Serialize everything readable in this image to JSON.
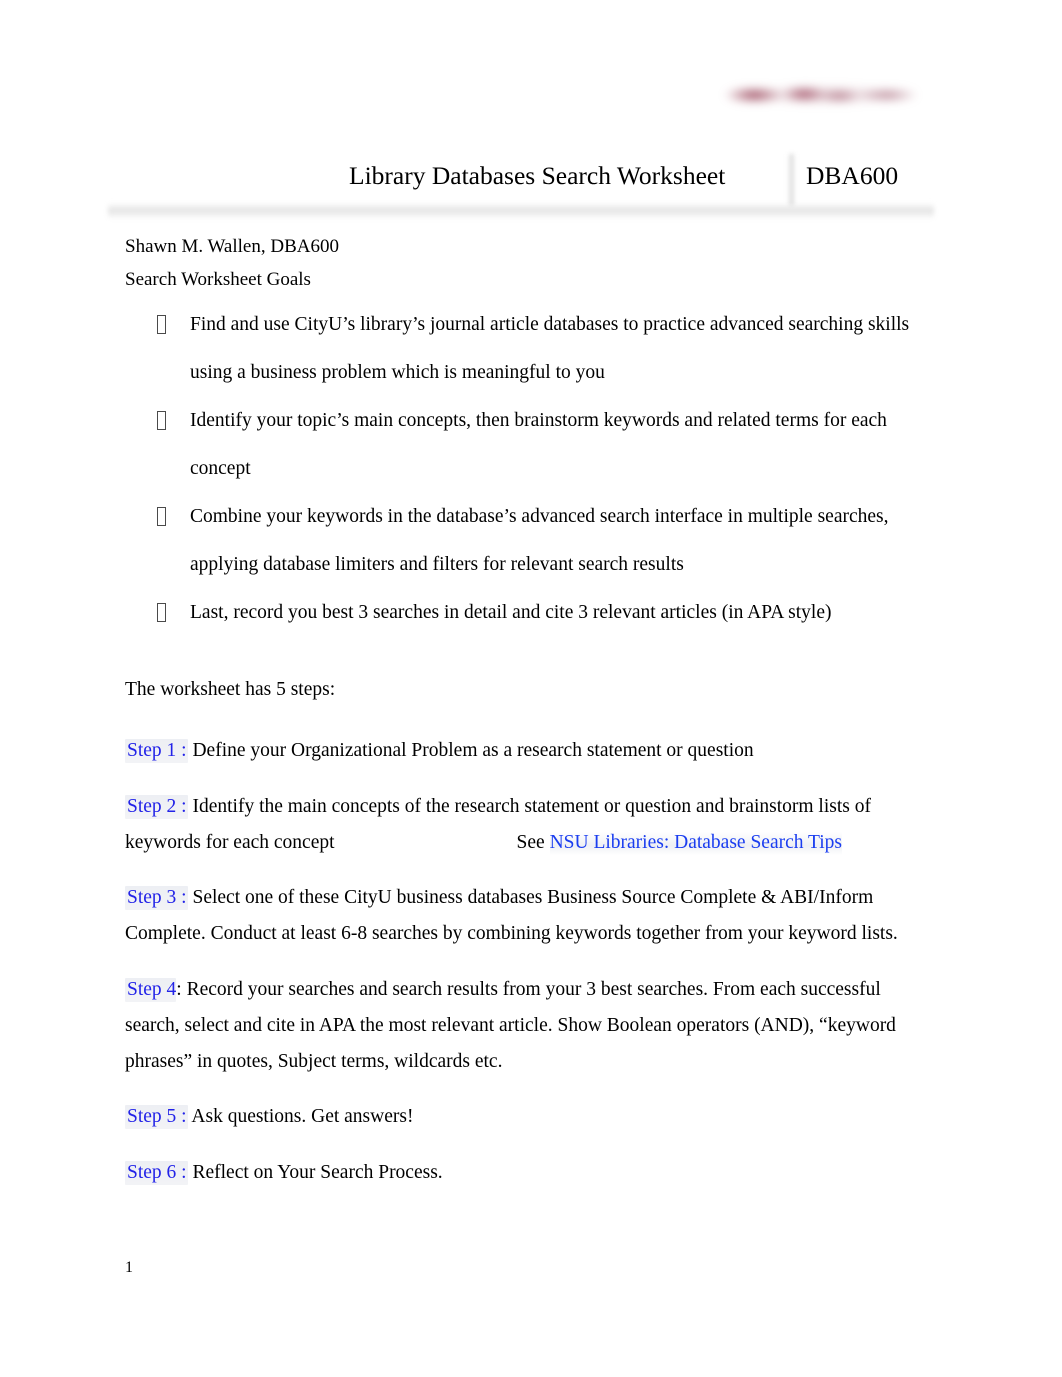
{
  "header": {
    "logo_alt": "blurred-university-logo",
    "logo_color": "#8c2a42",
    "title": "Library Databases Search Worksheet",
    "course_code": "DBA600"
  },
  "meta": {
    "author_line": "Shawn M. Wallen, DBA600",
    "section_heading": "Search Worksheet Goals"
  },
  "goals": [
    "Find and use CityU’s library’s journal article databases to practice advanced searching skills using a business problem which is meaningful to you",
    "Identify your topic’s main concepts, then brainstorm keywords and related terms for each concept",
    "Combine your keywords in the database’s advanced search interface in multiple searches, applying database limiters and filters for relevant search results",
    "Last, record you best 3 searches in detail and cite 3 relevant articles (in APA style)"
  ],
  "intro": "The worksheet has 5 steps:",
  "steps": [
    {
      "label": "Step 1 :",
      "label_text": "Step 1",
      "colon": " :",
      "body": " Define your Organizational Problem as a research statement or question"
    },
    {
      "label": "Step 2 :",
      "label_text": "Step 2",
      "colon": " :",
      "body": " Identify the main concepts of the research statement or question and brainstorm lists of keywords for each concept",
      "body_line1": " Identify the main concepts of the research statement or question and brainstorm lists of",
      "body_line2": "keywords for each concept",
      "see_label": "See",
      "link_text": "NSU Libraries: Database Search Tips"
    },
    {
      "label": "Step 3 :",
      "label_text": "Step 3",
      "colon": " :",
      "body": " Select one of these CityU business databases Business Source Complete & ABI/Inform Complete. Conduct at least 6-8 searches by combining keywords together from your keyword lists."
    },
    {
      "label": "Step 4 :",
      "label_text": "Step 4",
      "colon": ":",
      "body": " Record your searches and search results from your 3 best searches. From each successful search, select and cite in APA the most relevant article. Show Boolean operators (AND), “keyword phrases” in quotes, Subject terms, wildcards etc."
    },
    {
      "label": "Step 5 :",
      "label_text": "Step 5",
      "colon": " :",
      "body": " Ask questions. Get answers!"
    },
    {
      "label": "Step 6 :",
      "label_text": "Step 6",
      "colon": " :",
      "body": " Reflect on Your Search Process."
    }
  ],
  "footer": {
    "page_number": "1"
  },
  "colors": {
    "step_label_blue": "#2222e8",
    "link_blue": "#1a3df0",
    "logo_maroon": "#8c2a42",
    "text_black": "#000000"
  }
}
